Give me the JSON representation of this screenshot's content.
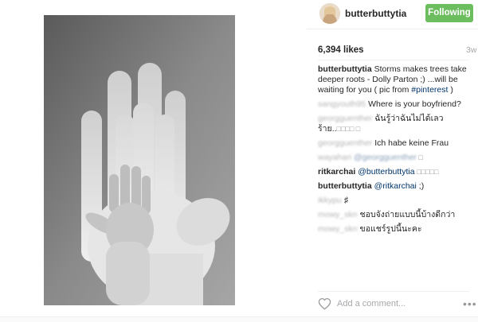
{
  "header": {
    "username": "butterbuttytia",
    "follow_label": "Following"
  },
  "post": {
    "likes": "6,394 likes",
    "age": "3w",
    "photo_description_icon": "hands-photo"
  },
  "comments": [
    {
      "author": "butterbuttytia",
      "text": "Storms makes trees take deeper roots - Dolly Parton ;) ...will be waiting for you ( pic from ",
      "tag": "#pinterest",
      "tail": " )",
      "blurred": false
    },
    {
      "author": "sangyouth95",
      "text": "Where is your boyfriend?",
      "blurred": true
    },
    {
      "author": "georgguenther",
      "text": "ฉันรู้ว่าฉันไม่ได้เลวร้าย..",
      "tail": "□□□□ □",
      "blurred": true
    },
    {
      "author": "georgguenther",
      "text": "Ich habe keine Frau",
      "blurred": true
    },
    {
      "author": "wayahari",
      "mention": "@georgguenther",
      "text": " □",
      "blurred": true
    },
    {
      "author": "ritkarchai",
      "mention": "@butterbuttytia",
      "text": " □□□□□",
      "blurred": false
    },
    {
      "author": "butterbuttytia",
      "mention": "@ritkarchai",
      "text": " ;)",
      "blurred": false
    },
    {
      "author": "ikkypu",
      "text": "♯",
      "blurred": true
    },
    {
      "author": "mowy_skn",
      "text": "ชอบจังถ่ายแบบนี้บ้างดีกว่า",
      "blurred": true
    },
    {
      "author": "mowy_skn",
      "text": "ขอแชร์รูปนี้นะคะ",
      "blurred": true
    }
  ],
  "add_comment": {
    "placeholder": "Add a comment..."
  },
  "icons": {
    "like": "heart-icon",
    "more": "more-options-icon"
  },
  "colors": {
    "follow_button": "#6bbd5e",
    "link": "#003569"
  }
}
